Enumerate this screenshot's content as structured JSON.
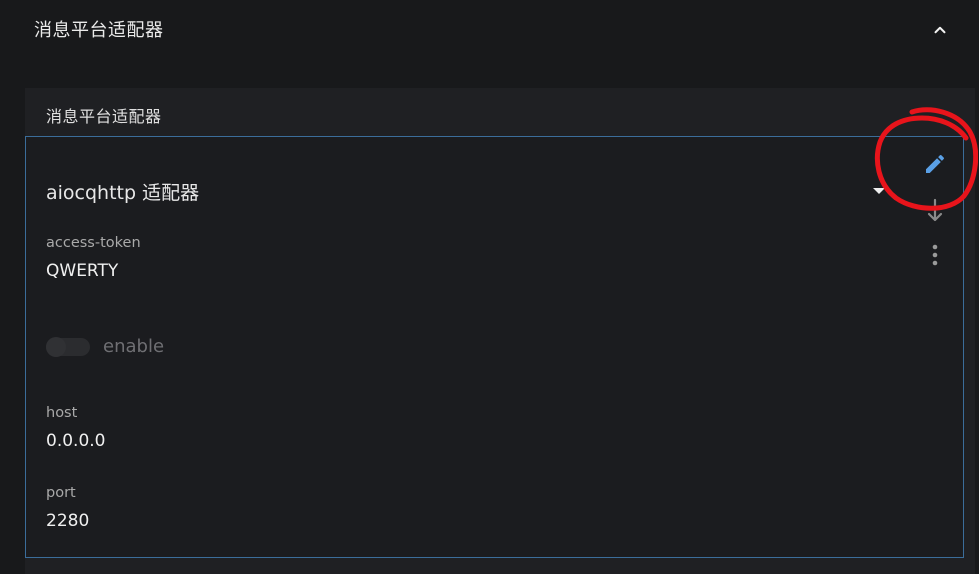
{
  "section": {
    "title": "消息平台适配器"
  },
  "panel": {
    "title": "消息平台适配器"
  },
  "card": {
    "title": "aiocqhttp 适配器",
    "fields": {
      "access_token": {
        "label": "access-token",
        "value": "QWERTY"
      },
      "enable": {
        "label": "enable",
        "checked": false
      },
      "host": {
        "label": "host",
        "value": "0.0.0.0"
      },
      "port": {
        "label": "port",
        "value": "2280"
      }
    }
  },
  "icons": {
    "collapse": "chevron-up-icon",
    "dropdown": "caret-down-icon",
    "edit": "pencil-icon",
    "download": "arrow-down-icon",
    "more": "more-vertical-icon"
  },
  "colors": {
    "edit_icon": "#5aa0e6",
    "card_border": "#3b6d9a",
    "annotation": "#e8141b"
  }
}
